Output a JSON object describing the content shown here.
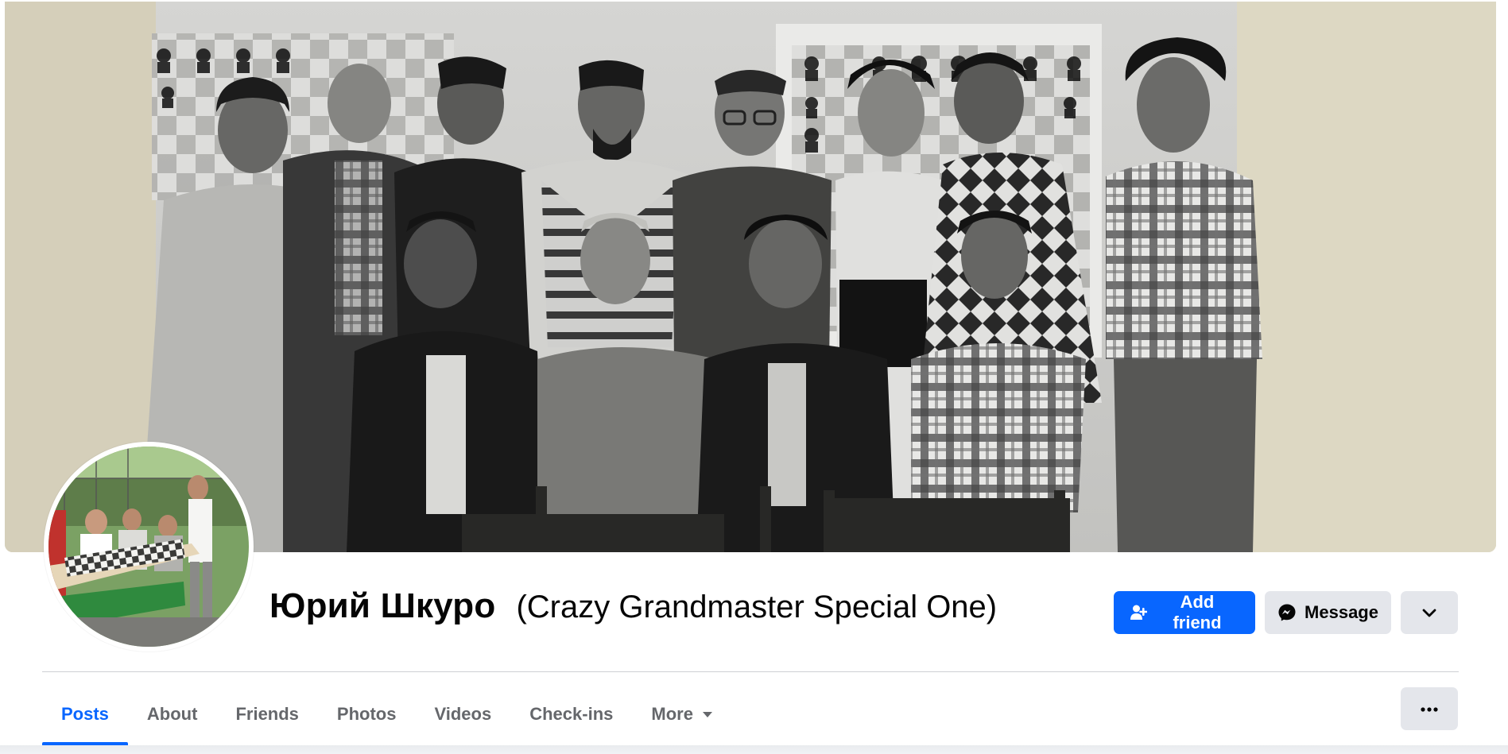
{
  "profile": {
    "name": "Юрий Шкуро",
    "alternate_name": "(Crazy Grandmaster Special One)"
  },
  "cover_photo": {
    "description_icon": "cover-photo"
  },
  "avatar": {
    "icon": "profile-picture"
  },
  "actions": {
    "add_friend_label": "Add friend",
    "add_friend_icon": "add-person-icon",
    "message_label": "Message",
    "message_icon": "messenger-icon",
    "dropdown_icon": "chevron-down-icon"
  },
  "tabs": [
    {
      "label": "Posts",
      "active": true
    },
    {
      "label": "About",
      "active": false
    },
    {
      "label": "Friends",
      "active": false
    },
    {
      "label": "Photos",
      "active": false
    },
    {
      "label": "Videos",
      "active": false
    },
    {
      "label": "Check-ins",
      "active": false
    },
    {
      "label": "More",
      "active": false,
      "has_caret": true
    }
  ],
  "tab_menu_icon": "ellipsis-icon",
  "colors": {
    "accent": "#0866ff",
    "secondary_button": "#e4e6eb",
    "text_primary": "#050505",
    "text_secondary": "#65676b",
    "divider": "#ced0d4"
  }
}
